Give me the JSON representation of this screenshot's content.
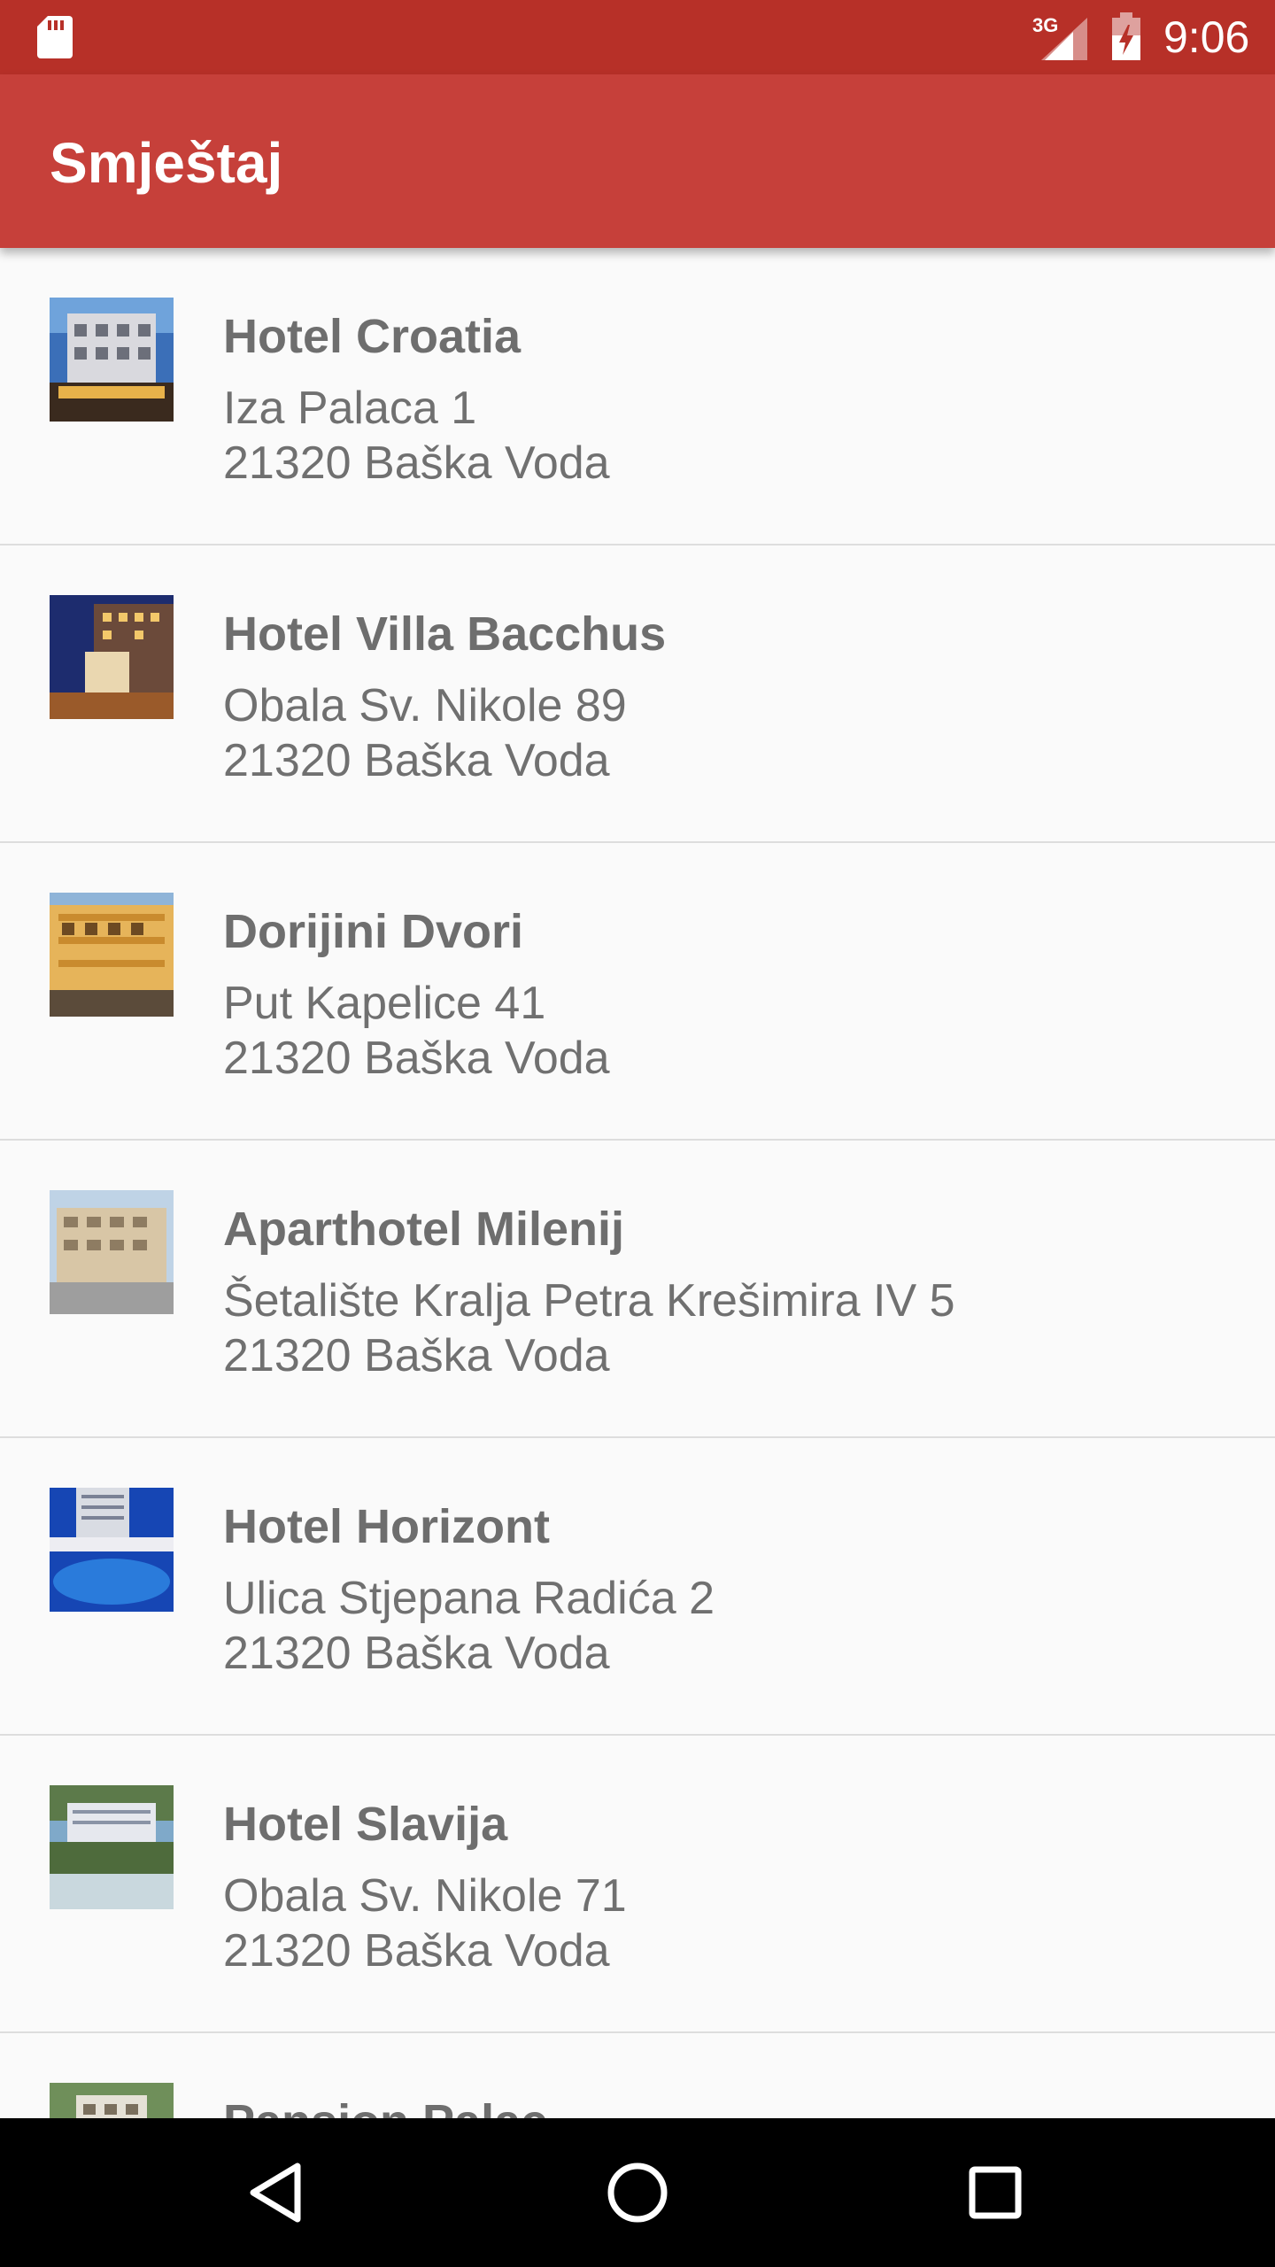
{
  "status_bar": {
    "network_label": "3G",
    "time": "9:06",
    "icons": [
      "sd-card-icon",
      "signal-icon",
      "battery-icon"
    ]
  },
  "app_bar": {
    "title": "Smještaj",
    "color": "#C6403A"
  },
  "items": [
    {
      "name": "Hotel Croatia",
      "address": "Iza Palaca 1",
      "city": "21320 Baška Voda"
    },
    {
      "name": "Hotel Villa Bacchus",
      "address": "Obala Sv. Nikole 89",
      "city": "21320 Baška Voda"
    },
    {
      "name": "Dorijini Dvori",
      "address": "Put Kapelice 41",
      "city": "21320 Baška Voda"
    },
    {
      "name": "Aparthotel Milenij",
      "address": "Šetalište Kralja Petra Krešimira IV 5",
      "city": "21320 Baška Voda"
    },
    {
      "name": "Hotel Horizont",
      "address": "Ulica Stjepana Radića 2",
      "city": "21320 Baška Voda"
    },
    {
      "name": "Hotel Slavija",
      "address": "Obala Sv. Nikole 71",
      "city": "21320 Baška Voda"
    },
    {
      "name": "Pansion Palac",
      "address": "",
      "city": ""
    }
  ],
  "nav_bar": {
    "buttons": [
      "back-icon",
      "home-icon",
      "recent-apps-icon"
    ]
  }
}
